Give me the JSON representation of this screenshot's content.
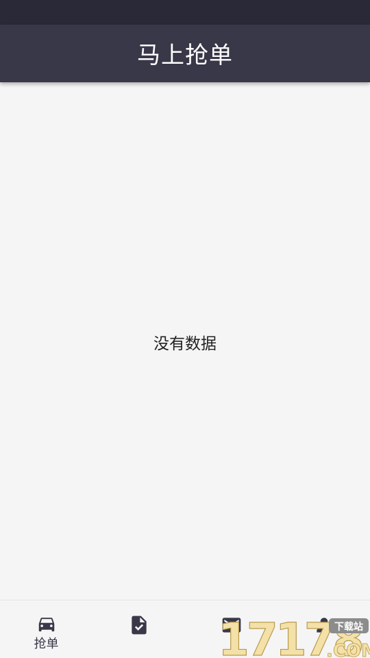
{
  "app_bar": {
    "title": "马上抢单"
  },
  "main": {
    "empty_text": "没有数据"
  },
  "bottom_nav": {
    "items": [
      {
        "label": "抢单",
        "icon": "car-icon",
        "selected": true
      },
      {
        "label": "",
        "icon": "document-check-icon",
        "selected": false
      },
      {
        "label": "",
        "icon": "mail-icon",
        "selected": false
      },
      {
        "label": "",
        "icon": "person-icon",
        "selected": false
      }
    ]
  },
  "watermark": {
    "text": "17178",
    "suffix": ".COM",
    "badge": "下载站"
  },
  "colors": {
    "status_bar": "#2a2938",
    "app_bar": "#393848",
    "background": "#f5f5f5",
    "nav_icon": "#393848"
  }
}
